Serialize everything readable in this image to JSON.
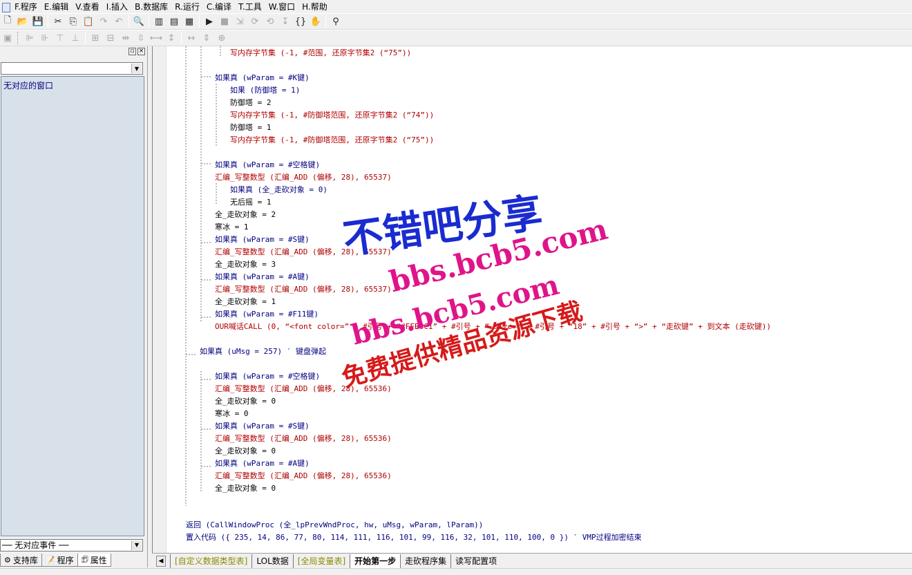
{
  "menu": [
    "F.程序",
    "E.编辑",
    "V.查看",
    "I.插入",
    "B.数据库",
    "R.运行",
    "C.编译",
    "T.工具",
    "W.窗口",
    "H.帮助"
  ],
  "left_panel": {
    "list_text": "无对应的窗口",
    "event_combo": "── 无对应事件 ──",
    "tabs": [
      "支持库",
      "程序",
      "属性"
    ]
  },
  "code_lines": [
    {
      "indent": 2,
      "text": "写内存字节集 (-1, #范围, 还原字节集2 (“75”))",
      "cls": "str"
    },
    {
      "indent": 0,
      "text": "",
      "cls": "op"
    },
    {
      "indent": 1,
      "text": "如果真 (wParam = #K键)",
      "cls": "kw"
    },
    {
      "indent": 2,
      "text": "如果 (防御塔 = 1)",
      "cls": "kw"
    },
    {
      "indent": 2,
      "text": "防御塔 = 2",
      "cls": "op"
    },
    {
      "indent": 2,
      "text": "写内存字节集 (-1, #防御塔范围, 还原字节集2 (“74”))",
      "cls": "str"
    },
    {
      "indent": 2,
      "text": "防御塔 = 1",
      "cls": "op"
    },
    {
      "indent": 2,
      "text": "写内存字节集 (-1, #防御塔范围, 还原字节集2 (“75”))",
      "cls": "str"
    },
    {
      "indent": 0,
      "text": "",
      "cls": "op"
    },
    {
      "indent": 1,
      "text": "如果真 (wParam = #空格键)",
      "cls": "kw"
    },
    {
      "indent": 1,
      "text": "汇编_写整数型 (汇编_ADD (偏移, 28), 65537)",
      "cls": "str"
    },
    {
      "indent": 2,
      "text": "如果真 (全_走砍对象 = 0)",
      "cls": "kw"
    },
    {
      "indent": 2,
      "text": "无后摇 = 1",
      "cls": "op"
    },
    {
      "indent": 1,
      "text": "全_走砍对象 = 2",
      "cls": "op"
    },
    {
      "indent": 1,
      "text": "寒冰 = 1",
      "cls": "op"
    },
    {
      "indent": 1,
      "text": "如果真 (wParam = #S键)",
      "cls": "kw"
    },
    {
      "indent": 1,
      "text": "汇编_写整数型 (汇编_ADD (偏移, 28), 65537)",
      "cls": "str"
    },
    {
      "indent": 1,
      "text": "全_走砍对象 = 3",
      "cls": "op"
    },
    {
      "indent": 1,
      "text": "如果真 (wParam = #A键)",
      "cls": "kw"
    },
    {
      "indent": 1,
      "text": "汇编_写整数型 (汇编_ADD (偏移, 28), 65537)",
      "cls": "str"
    },
    {
      "indent": 1,
      "text": "全_走砍对象 = 1",
      "cls": "op"
    },
    {
      "indent": 1,
      "text": "如果真 (wParam = #F11键)",
      "cls": "kw"
    },
    {
      "indent": 1,
      "text": "OUR喊话CALL (0, “<font color=” + #引号 + “#FFB6C1” + #引号 + “ size=” + #引号 + “18” + #引号 + “>” + “走砍键” + 到文本 (走砍键))",
      "cls": "str"
    },
    {
      "indent": 0,
      "text": "",
      "cls": "op"
    },
    {
      "indent": 0,
      "text": "如果真 (uMsg = 257) ′ 键盘弹起",
      "cls": "kw"
    },
    {
      "indent": 0,
      "text": "",
      "cls": "op"
    },
    {
      "indent": 1,
      "text": "如果真 (wParam = #空格键)",
      "cls": "kw"
    },
    {
      "indent": 1,
      "text": "汇编_写整数型 (汇编_ADD (偏移, 28), 65536)",
      "cls": "str"
    },
    {
      "indent": 1,
      "text": "全_走砍对象 = 0",
      "cls": "op"
    },
    {
      "indent": 1,
      "text": "寒冰 = 0",
      "cls": "op"
    },
    {
      "indent": 1,
      "text": "如果真 (wParam = #S键)",
      "cls": "kw"
    },
    {
      "indent": 1,
      "text": "汇编_写整数型 (汇编_ADD (偏移, 28), 65536)",
      "cls": "str"
    },
    {
      "indent": 1,
      "text": "全_走砍对象 = 0",
      "cls": "op"
    },
    {
      "indent": 1,
      "text": "如果真 (wParam = #A键)",
      "cls": "kw"
    },
    {
      "indent": 1,
      "text": "汇编_写整数型 (汇编_ADD (偏移, 28), 65536)",
      "cls": "str"
    },
    {
      "indent": 1,
      "text": "全_走砍对象 = 0",
      "cls": "op"
    },
    {
      "indent": 0,
      "text": "",
      "cls": "op"
    },
    {
      "indent": 0,
      "text": "",
      "cls": "op"
    },
    {
      "indent": -1,
      "text": "返回 (CallWindowProc (全_lpPrevWndProc, hw, uMsg, wParam, lParam))",
      "cls": "kw"
    },
    {
      "indent": -1,
      "text": "置入代码 ({ 235, 14, 86, 77, 80, 114, 111, 116, 101, 99, 116, 32, 101, 110, 100, 0 }) ′ VMP过程加密结束",
      "cls": "kw"
    }
  ],
  "bottom_tabs": [
    "[自定义数据类型表]",
    "LOL数据",
    "[全局变量表]",
    "开始第一步",
    "走砍程序集",
    "读写配置项"
  ],
  "watermark": {
    "line1": "不错吧分享",
    "line2": "bbs.bcb5.com",
    "line3": "bbs.bcb5.com",
    "line4": "免费提供精品资源下载"
  },
  "colors": {
    "keyword": "#000080",
    "string": "#b00000",
    "comment": "#007a00",
    "panel": "#d8e1ea"
  }
}
